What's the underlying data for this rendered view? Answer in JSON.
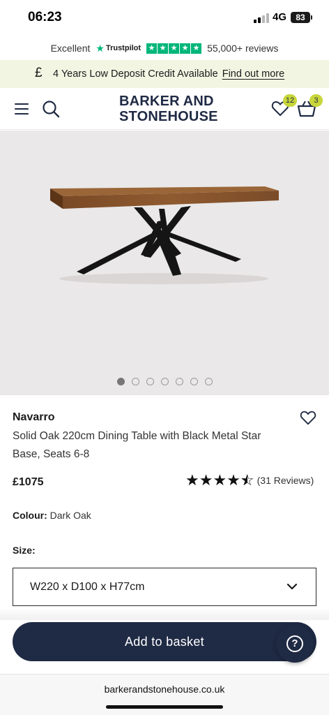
{
  "status_bar": {
    "time": "06:23",
    "network": "4G",
    "battery": "83"
  },
  "trustpilot": {
    "rating_word": "Excellent",
    "brand": "Trustpilot",
    "reviews": "55,000+ reviews"
  },
  "promo": {
    "icon": "£",
    "text": "4 Years Low Deposit Credit Available",
    "link": "Find out more"
  },
  "header": {
    "logo_line1": "BARKER AND",
    "logo_line2": "STONEHOUSE",
    "wishlist_count": "12",
    "basket_count": "3"
  },
  "gallery": {
    "image_count": 7,
    "active_index": 0
  },
  "product": {
    "brand": "Navarro",
    "title": "Solid Oak 220cm Dining Table with Black Metal Star Base, Seats 6-8",
    "price": "£1075",
    "rating_stars": 4.5,
    "reviews": "(31 Reviews)",
    "colour_label": "Colour:",
    "colour_value": "Dark Oak",
    "size_label": "Size:",
    "size_value": "W220 x D100 x H77cm"
  },
  "actions": {
    "add_to_basket": "Add to basket",
    "help_symbol": "?"
  },
  "browser": {
    "url": "barkerandstonehouse.co.uk"
  },
  "colors": {
    "navy": "#1f2a44",
    "badge": "#c8d63a",
    "trustpilot_green": "#00b67a",
    "promo_bg": "#f3f5e3"
  }
}
